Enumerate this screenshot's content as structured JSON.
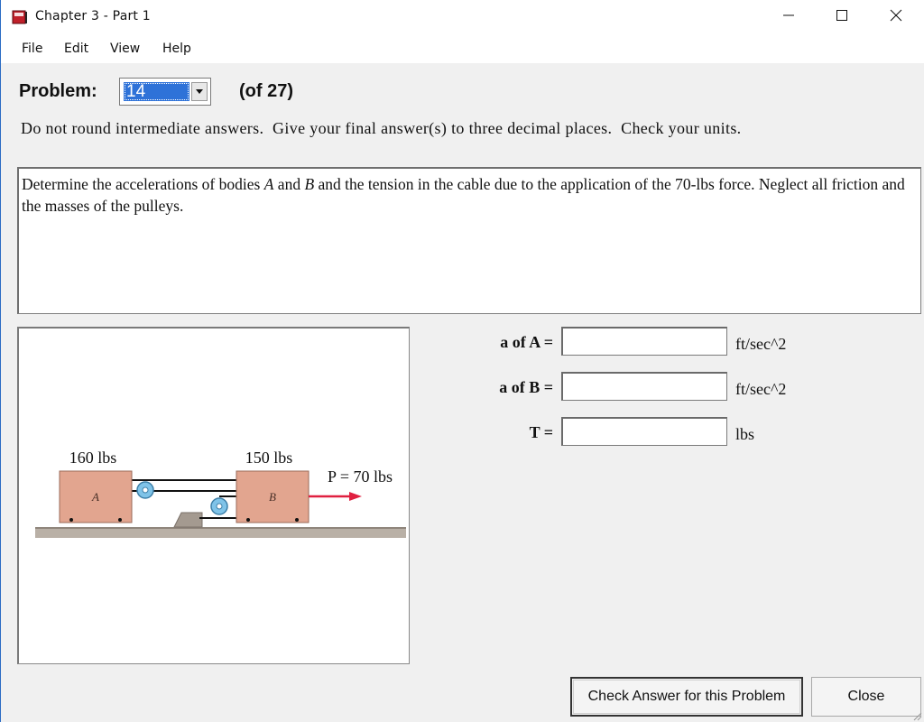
{
  "window": {
    "title": "Chapter 3 - Part 1",
    "accent_color": "#2e72d8"
  },
  "menu": {
    "items": [
      {
        "label": "File"
      },
      {
        "label": "Edit"
      },
      {
        "label": "View"
      },
      {
        "label": "Help"
      }
    ]
  },
  "problem": {
    "label": "Problem:",
    "selected": "14",
    "total_label": "(of 27)"
  },
  "instructions": "Do not round intermediate answers.  Give your final answer(s) to three decimal places.  Check your units.",
  "statement": {
    "part1": "Determine the accelerations of bodies ",
    "body_a": "A",
    "part2": " and ",
    "body_b": "B",
    "part3": " and the tension in the cable due to the application of the 70-lbs force. Neglect all friction and the masses of the pulleys."
  },
  "figure": {
    "weight_a": "160 lbs",
    "weight_b": "150 lbs",
    "force_label": "P = 70 lbs",
    "block_a_label": "A",
    "block_b_label": "B",
    "block_color": "#e2a58f",
    "arrow_color": "#e02040",
    "pulley_color": "#7fc3e8"
  },
  "answers": [
    {
      "label": "a of A =",
      "value": "",
      "unit": "ft/sec^2"
    },
    {
      "label": "a of B =",
      "value": "",
      "unit": "ft/sec^2"
    },
    {
      "label": "T =",
      "value": "",
      "unit": "lbs"
    }
  ],
  "buttons": {
    "check": "Check Answer for this Problem",
    "close": "Close"
  }
}
